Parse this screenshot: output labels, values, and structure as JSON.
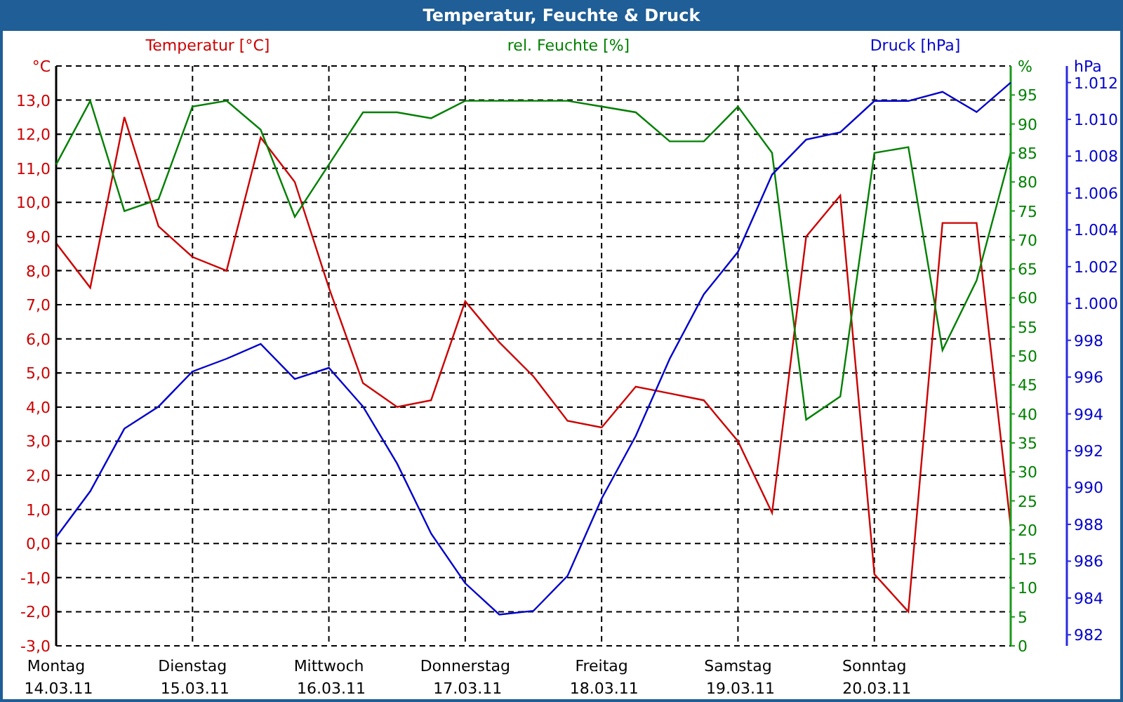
{
  "window": {
    "title": "Temperatur, Feuchte & Druck"
  },
  "charts": [
    {
      "chart_data": {
        "type": "line",
        "grid": true,
        "ylabel": "°C",
        "ylim": [
          -3,
          14
        ],
        "categories": [
          "Montag 14.03.11",
          null,
          null,
          null,
          "Dienstag 15.03.11",
          null,
          null,
          null,
          "Mittwoch 16.03.11",
          null,
          null,
          null,
          "Donnerstag 17.03.11",
          null,
          null,
          null,
          "Freitag 18.03.11",
          null,
          null,
          null,
          "Samstag 19.03.11",
          null,
          null,
          null,
          "Sonntag 20.03.11",
          null,
          null,
          null,
          null
        ],
        "yticks": [
          {
            "value": -3,
            "label": "-3,0"
          },
          {
            "value": -2,
            "label": "-2,0"
          },
          {
            "value": -1,
            "label": "-1,0"
          },
          {
            "value": 0,
            "label": "0,0"
          },
          {
            "value": 1,
            "label": "1,0"
          },
          {
            "value": 2,
            "label": "2,0"
          },
          {
            "value": 3,
            "label": "3,0"
          },
          {
            "value": 4,
            "label": "4,0"
          },
          {
            "value": 5,
            "label": "5,0"
          },
          {
            "value": 6,
            "label": "6,0"
          },
          {
            "value": 7,
            "label": "7,0"
          },
          {
            "value": 8,
            "label": "8,0"
          },
          {
            "value": 9,
            "label": "9,0"
          },
          {
            "value": 10,
            "label": "10,0"
          },
          {
            "value": 11,
            "label": "11,0"
          },
          {
            "value": 12,
            "label": "12,0"
          },
          {
            "value": 13,
            "label": "13,0"
          }
        ],
        "series": [
          {
            "name": "Temperatur [°C]",
            "color": "#cc0000",
            "values": [
              8.8,
              7.5,
              12.5,
              9.3,
              8.4,
              8.0,
              11.9,
              10.6,
              7.5,
              4.7,
              4.0,
              4.2,
              7.1,
              5.9,
              4.9,
              3.6,
              3.4,
              4.6,
              4.4,
              4.2,
              3.0,
              0.9,
              9.0,
              10.2,
              -0.9,
              -2.0,
              9.4,
              9.4,
              0.5
            ]
          }
        ]
      }
    },
    {
      "chart_data": {
        "type": "line",
        "ylabel": "%",
        "ylim": [
          0,
          100
        ],
        "categories": [
          null,
          null,
          null,
          null,
          null,
          null,
          null,
          null,
          null,
          null,
          null,
          null,
          null,
          null,
          null,
          null,
          null,
          null,
          null,
          null,
          null,
          null,
          null,
          null,
          null,
          null,
          null,
          null,
          null
        ],
        "yticks": [
          0,
          5,
          10,
          15,
          20,
          25,
          30,
          35,
          40,
          45,
          50,
          55,
          60,
          65,
          70,
          75,
          80,
          85,
          90,
          95
        ],
        "series": [
          {
            "name": "rel. Feuchte [%]",
            "color": "#008000",
            "values": [
              83,
              94,
              75,
              77,
              93,
              94,
              89,
              74,
              83,
              92,
              92,
              91,
              94,
              94,
              94,
              94,
              93,
              92,
              87,
              87,
              93,
              85,
              39,
              43,
              85,
              86,
              51,
              63,
              85
            ]
          }
        ]
      }
    },
    {
      "chart_data": {
        "type": "line",
        "ylabel": "hPa",
        "ylim": [
          981.4,
          1012.9
        ],
        "categories": [
          null,
          null,
          null,
          null,
          null,
          null,
          null,
          null,
          null,
          null,
          null,
          null,
          null,
          null,
          null,
          null,
          null,
          null,
          null,
          null,
          null,
          null,
          null,
          null,
          null,
          null,
          null,
          null,
          null
        ],
        "yticks": [
          {
            "value": 982,
            "label": "982"
          },
          {
            "value": 984,
            "label": "984"
          },
          {
            "value": 986,
            "label": "986"
          },
          {
            "value": 988,
            "label": "988"
          },
          {
            "value": 990,
            "label": "990"
          },
          {
            "value": 992,
            "label": "992"
          },
          {
            "value": 994,
            "label": "994"
          },
          {
            "value": 996,
            "label": "996"
          },
          {
            "value": 998,
            "label": "998"
          },
          {
            "value": 1000,
            "label": "1.000"
          },
          {
            "value": 1002,
            "label": "1.002"
          },
          {
            "value": 1004,
            "label": "1.004"
          },
          {
            "value": 1006,
            "label": "1.006"
          },
          {
            "value": 1008,
            "label": "1.008"
          },
          {
            "value": 1010,
            "label": "1.010"
          },
          {
            "value": 1012,
            "label": "1.012"
          }
        ],
        "series": [
          {
            "name": "Druck [hPa]",
            "color": "#0000cc",
            "values": [
              987.3,
              989.8,
              993.2,
              994.4,
              996.3,
              997.0,
              997.8,
              995.9,
              996.5,
              994.4,
              991.3,
              987.5,
              984.8,
              983.1,
              983.3,
              985.2,
              989.4,
              992.8,
              997.0,
              1000.5,
              1002.8,
              1007.0,
              1008.9,
              1009.3,
              1011.0,
              1011.0,
              1011.5,
              1010.4,
              1012.0
            ]
          }
        ]
      }
    }
  ]
}
